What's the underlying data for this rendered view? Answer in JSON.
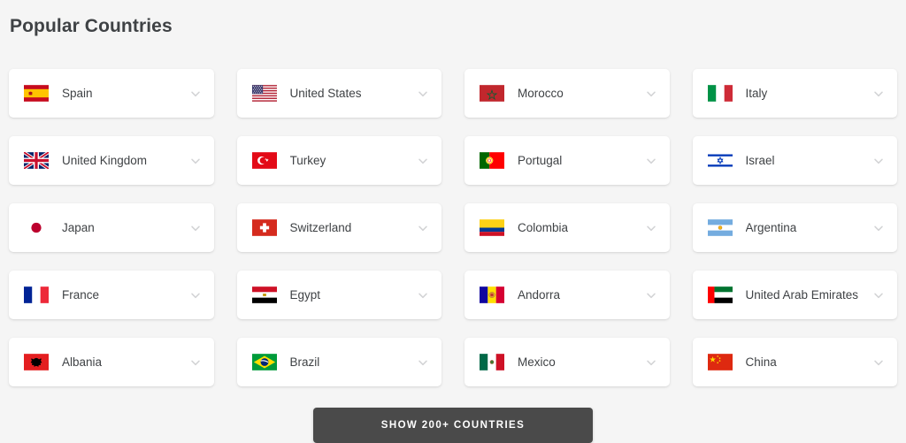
{
  "page": {
    "title": "Popular Countries",
    "background_color": "#f5f5f5",
    "text_color": "#3f4245"
  },
  "grid": {
    "columns": 4,
    "rows": 5,
    "chevron_icon": "chevron-down-icon",
    "countries": [
      {
        "name": "Spain",
        "flag": "es"
      },
      {
        "name": "United States",
        "flag": "us"
      },
      {
        "name": "Morocco",
        "flag": "ma"
      },
      {
        "name": "Italy",
        "flag": "it"
      },
      {
        "name": "United Kingdom",
        "flag": "gb"
      },
      {
        "name": "Turkey",
        "flag": "tr"
      },
      {
        "name": "Portugal",
        "flag": "pt"
      },
      {
        "name": "Israel",
        "flag": "il"
      },
      {
        "name": "Japan",
        "flag": "jp"
      },
      {
        "name": "Switzerland",
        "flag": "ch"
      },
      {
        "name": "Colombia",
        "flag": "co"
      },
      {
        "name": "Argentina",
        "flag": "ar"
      },
      {
        "name": "France",
        "flag": "fr"
      },
      {
        "name": "Egypt",
        "flag": "eg"
      },
      {
        "name": "Andorra",
        "flag": "ad"
      },
      {
        "name": "United Arab Emirates",
        "flag": "ae"
      },
      {
        "name": "Albania",
        "flag": "al"
      },
      {
        "name": "Brazil",
        "flag": "br"
      },
      {
        "name": "Mexico",
        "flag": "mx"
      },
      {
        "name": "China",
        "flag": "cn"
      }
    ]
  },
  "footer": {
    "show_all_label": "Show 200+ countries",
    "button_color": "#4a4a4a"
  }
}
